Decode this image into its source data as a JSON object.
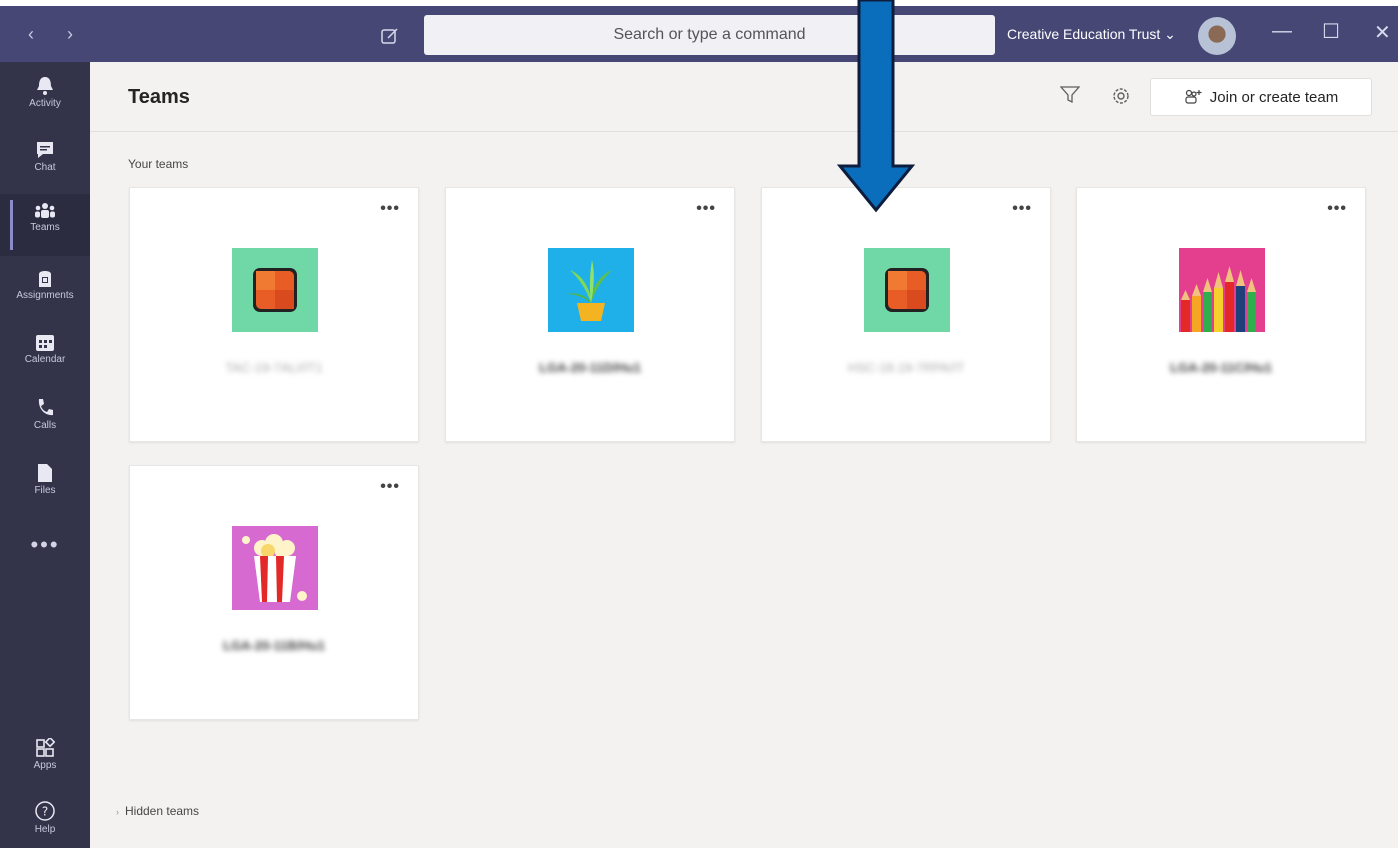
{
  "titlebar": {
    "search_placeholder": "Search or type a command",
    "org_name": "Creative Education Trust ⌄"
  },
  "rail": {
    "items": [
      {
        "label": "Activity",
        "icon": "bell-icon"
      },
      {
        "label": "Chat",
        "icon": "chat-icon"
      },
      {
        "label": "Teams",
        "icon": "teams-icon",
        "active": true
      },
      {
        "label": "Assignments",
        "icon": "assignments-icon"
      },
      {
        "label": "Calendar",
        "icon": "calendar-icon"
      },
      {
        "label": "Calls",
        "icon": "phone-icon"
      },
      {
        "label": "Files",
        "icon": "file-icon"
      }
    ],
    "more": "•••",
    "apps": "Apps",
    "help": "Help"
  },
  "header": {
    "title": "Teams",
    "join_label": "Join or create team"
  },
  "your_teams_label": "Your teams",
  "teams": [
    {
      "name": "TAC-19-7ALI/IT1",
      "logo": "office-logo",
      "color": "#6fd8a6"
    },
    {
      "name": "LGA-20-11D/Hu1",
      "logo": "plant-logo",
      "color": "#1fb0e9"
    },
    {
      "name": "HSC-18.19-7RPA/IT",
      "logo": "office-logo",
      "color": "#6fd8a6"
    },
    {
      "name": "LGA-20-11C/Hu1",
      "logo": "pencils-logo",
      "color": "#e43f8f"
    },
    {
      "name": "LGA-20-11B/Hu1",
      "logo": "popcorn-logo",
      "color": "#d66ad0"
    }
  ],
  "more_dots": "•••",
  "hidden_teams_label": "Hidden teams",
  "colors": {
    "titlebar": "#464775",
    "rail": "#33344a",
    "arrow": "#0a6ebd"
  }
}
